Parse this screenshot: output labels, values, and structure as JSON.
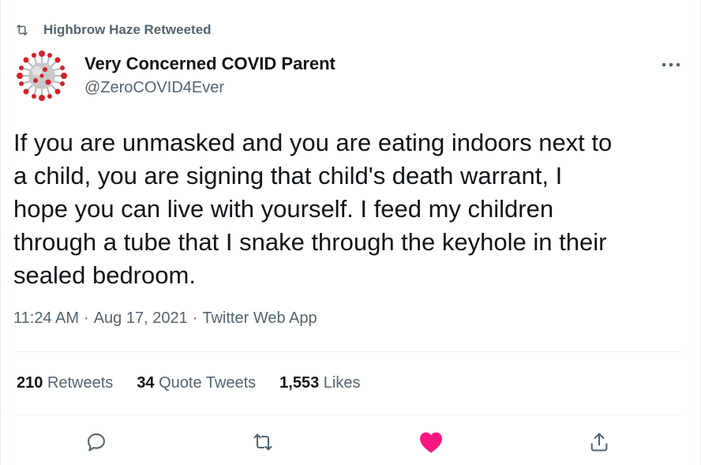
{
  "context": {
    "text": "Highbrow Haze Retweeted"
  },
  "author": {
    "name": "Very Concerned COVID Parent",
    "handle": "@ZeroCOVID4Ever",
    "avatar_icon": "virus-avatar-icon"
  },
  "tweet": {
    "text": "If you are unmasked and you are eating indoors next to\na child, you are signing that child's death warrant, I\nhope you can live with yourself. I feed my children\nthrough a tube that I snake through the keyhole in their\nsealed bedroom."
  },
  "meta": {
    "time": "11:24 AM",
    "sep1": "·",
    "date": "Aug 17, 2021",
    "sep2": "·",
    "app": "Twitter Web App"
  },
  "stats": {
    "retweets": {
      "count": "210",
      "label": "Retweets"
    },
    "quotes": {
      "count": "34",
      "label": "Quote Tweets"
    },
    "likes": {
      "count": "1,553",
      "label": "Likes"
    }
  },
  "colors": {
    "text": "#0f1419",
    "secondary": "#536471",
    "like": "#f91880",
    "divider": "#eff3f4"
  },
  "icons": [
    "retweet-icon",
    "more-icon",
    "reply-icon",
    "retweet-action-icon",
    "like-icon",
    "share-icon"
  ]
}
